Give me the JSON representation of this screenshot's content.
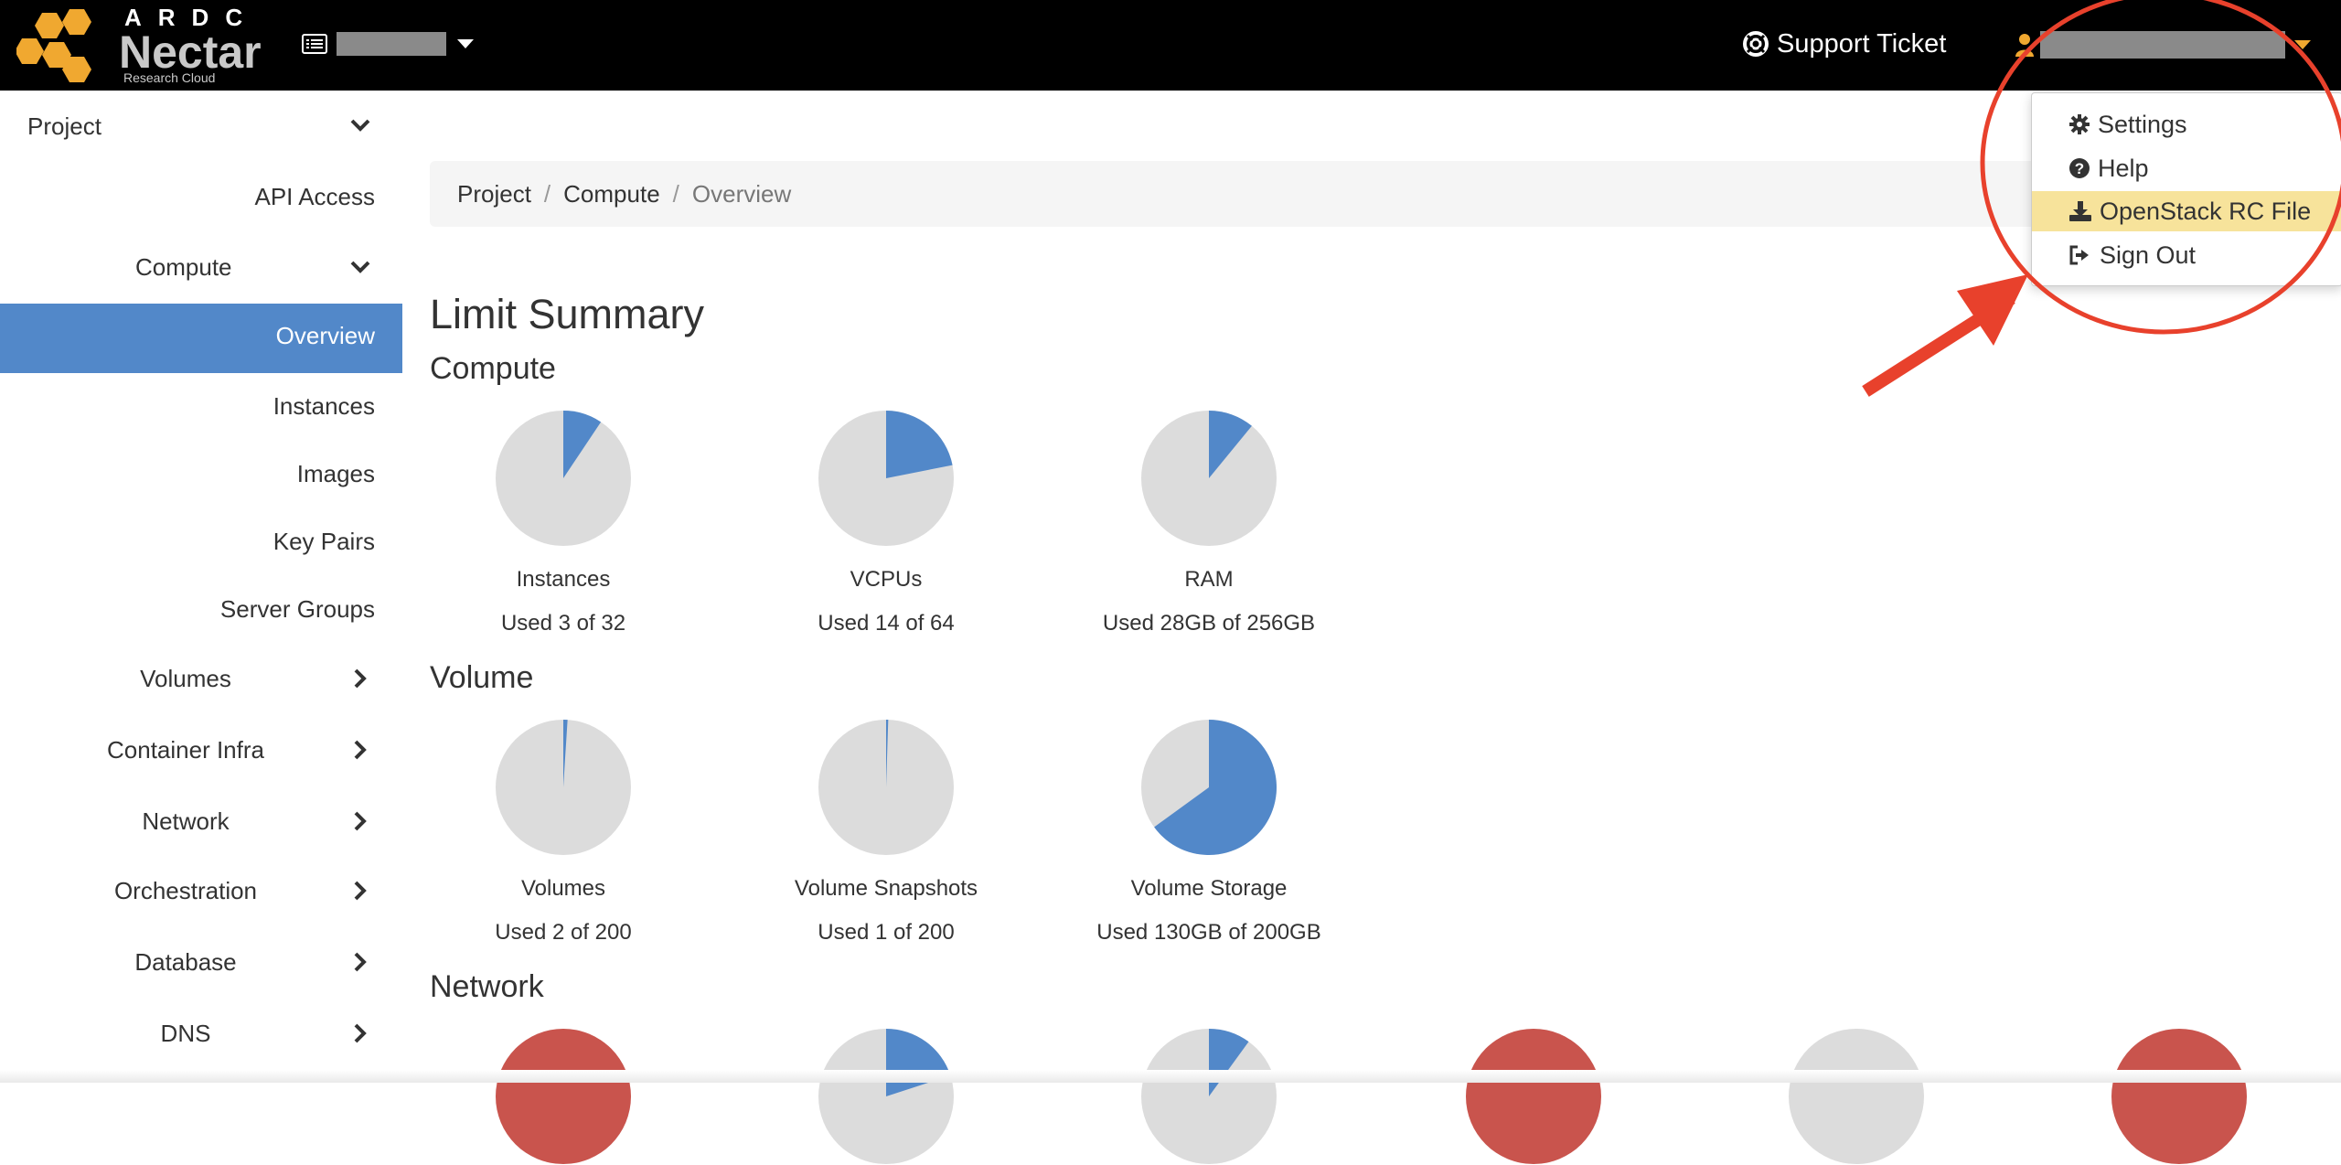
{
  "header": {
    "logo": {
      "brand_top": "ARDC",
      "brand_name": "Nectar",
      "brand_sub": "Research Cloud"
    },
    "support_label": "Support Ticket",
    "colors": {
      "background": "#000000",
      "accent": "#f0a830"
    }
  },
  "user_menu": {
    "items": [
      {
        "label": "Settings",
        "icon": "gear-icon"
      },
      {
        "label": "Help",
        "icon": "question-circle-icon"
      },
      {
        "label": "OpenStack RC File",
        "icon": "download-icon",
        "highlighted": true
      },
      {
        "label": "Sign Out",
        "icon": "sign-out-icon"
      }
    ]
  },
  "sidebar": {
    "items": [
      {
        "label": "Project",
        "expanded": true
      },
      {
        "label": "API Access"
      },
      {
        "label": "Compute",
        "expanded": true
      },
      {
        "label": "Overview",
        "active": true
      },
      {
        "label": "Instances"
      },
      {
        "label": "Images"
      },
      {
        "label": "Key Pairs"
      },
      {
        "label": "Server Groups"
      },
      {
        "label": "Volumes",
        "expanded": false
      },
      {
        "label": "Container Infra",
        "expanded": false
      },
      {
        "label": "Network",
        "expanded": false
      },
      {
        "label": "Orchestration",
        "expanded": false
      },
      {
        "label": "Database",
        "expanded": false
      },
      {
        "label": "DNS",
        "expanded": false
      }
    ],
    "active_color": "#5288c9"
  },
  "breadcrumb": [
    "Project",
    "Compute",
    "Overview"
  ],
  "page_title": "Limit Summary",
  "sections": {
    "compute": {
      "title": "Compute",
      "pies": [
        {
          "label": "Instances",
          "used_text": "Used 3 of 32",
          "fraction": 0.09375
        },
        {
          "label": "VCPUs",
          "used_text": "Used 14 of 64",
          "fraction": 0.21875
        },
        {
          "label": "RAM",
          "used_text": "Used 28GB of 256GB",
          "fraction": 0.109375
        }
      ]
    },
    "volume": {
      "title": "Volume",
      "pies": [
        {
          "label": "Volumes",
          "used_text": "Used 2 of 200",
          "fraction": 0.01
        },
        {
          "label": "Volume Snapshots",
          "used_text": "Used 1 of 200",
          "fraction": 0.005
        },
        {
          "label": "Volume Storage",
          "used_text": "Used 130GB of 200GB",
          "fraction": 0.65
        }
      ]
    },
    "network": {
      "title": "Network",
      "pies": [
        {
          "fraction": 1.0,
          "full_red": true
        },
        {
          "fraction": 0.2
        },
        {
          "fraction": 0.1
        },
        {
          "fraction": 1.0,
          "full_red": true
        },
        {
          "fraction": 0.0
        },
        {
          "fraction": 1.0,
          "full_red": true
        }
      ]
    }
  },
  "colors": {
    "pie_used": "#5288c9",
    "pie_free": "#dcdcdc",
    "pie_full": "#c9544d",
    "annotation": "#e8412c"
  }
}
